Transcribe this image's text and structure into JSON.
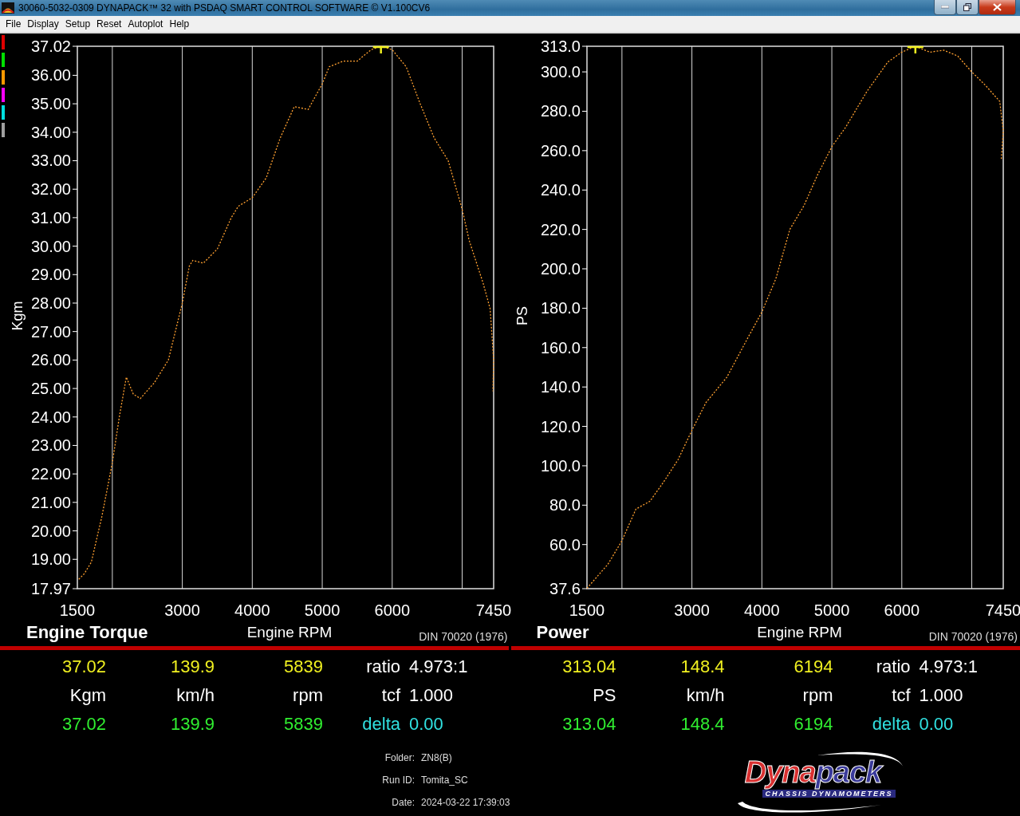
{
  "window": {
    "title": "30060-5032-0309 DYNAPACK™ 32 with PSDAQ SMART CONTROL SOFTWARE © V1.100CV6"
  },
  "menu": [
    "File",
    "Display",
    "Setup",
    "Reset",
    "Autoplot",
    "Help"
  ],
  "run_markers": [
    {
      "color": "#e00000"
    },
    {
      "color": "#00e000"
    },
    {
      "color": "#ff9900"
    },
    {
      "color": "#ff00ff"
    },
    {
      "color": "#00e0e0"
    },
    {
      "color": "#a0a0a0"
    }
  ],
  "charts": [
    {
      "title": "Engine Torque",
      "standard": "DIN 70020 (1976)",
      "chart_data": {
        "type": "line",
        "xlabel": "Engine RPM",
        "ylabel": "Kgm",
        "xlim": [
          1500,
          7450
        ],
        "ylim": [
          17.97,
          37.02
        ],
        "xticks": [
          1500,
          3000,
          4000,
          5000,
          6000,
          7450
        ],
        "yticks": [
          {
            "value": 17.97,
            "label": "17.97"
          },
          {
            "value": 19,
            "label": "19.00"
          },
          {
            "value": 20,
            "label": "20.00"
          },
          {
            "value": 21,
            "label": "21.00"
          },
          {
            "value": 22,
            "label": "22.00"
          },
          {
            "value": 23,
            "label": "23.00"
          },
          {
            "value": 24,
            "label": "24.00"
          },
          {
            "value": 25,
            "label": "25.00"
          },
          {
            "value": 26,
            "label": "26.00"
          },
          {
            "value": 27,
            "label": "27.00"
          },
          {
            "value": 28,
            "label": "28.00"
          },
          {
            "value": 29,
            "label": "29.00"
          },
          {
            "value": 30,
            "label": "30.00"
          },
          {
            "value": 31,
            "label": "31.00"
          },
          {
            "value": 32,
            "label": "32.00"
          },
          {
            "value": 33,
            "label": "33.00"
          },
          {
            "value": 34,
            "label": "34.00"
          },
          {
            "value": 35,
            "label": "35.00"
          },
          {
            "value": 36,
            "label": "36.00"
          },
          {
            "value": 37.02,
            "label": "37.02"
          }
        ],
        "x": [
          1520,
          1600,
          1700,
          1850,
          2000,
          2100,
          2200,
          2300,
          2400,
          2600,
          2800,
          3000,
          3100,
          3150,
          3300,
          3500,
          3700,
          3800,
          4000,
          4200,
          4400,
          4600,
          4800,
          5000,
          5100,
          5300,
          5500,
          5700,
          5839,
          6000,
          6200,
          6400,
          6600,
          6800,
          7000,
          7100,
          7300,
          7400,
          7450,
          7440
        ],
        "grid": true,
        "series": [
          {
            "color": "#ffa030",
            "line_style": "dotted",
            "values": [
              18.3,
              18.5,
              18.9,
              20.5,
              22.4,
              24.0,
              25.4,
              24.8,
              24.65,
              25.2,
              26.0,
              28.0,
              29.3,
              29.5,
              29.4,
              29.9,
              31.0,
              31.4,
              31.7,
              32.4,
              33.8,
              34.9,
              34.8,
              35.7,
              36.3,
              36.5,
              36.5,
              36.9,
              37.02,
              36.9,
              36.3,
              35.0,
              33.8,
              33.0,
              31.3,
              30.2,
              28.7,
              27.8,
              26.0,
              24.9
            ]
          }
        ]
      }
    },
    {
      "title": "Power",
      "standard": "DIN 70020 (1976)",
      "chart_data": {
        "type": "line",
        "xlabel": "Engine RPM",
        "ylabel": "PS",
        "xlim": [
          1500,
          7450
        ],
        "ylim": [
          37.6,
          313.0
        ],
        "xticks": [
          1500,
          3000,
          4000,
          5000,
          6000,
          7450
        ],
        "yticks": [
          {
            "value": 37.6,
            "label": "37.6"
          },
          {
            "value": 60,
            "label": "60.0"
          },
          {
            "value": 80,
            "label": "80.0"
          },
          {
            "value": 100,
            "label": "100.0"
          },
          {
            "value": 120,
            "label": "120.0"
          },
          {
            "value": 140,
            "label": "140.0"
          },
          {
            "value": 160,
            "label": "160.0"
          },
          {
            "value": 180,
            "label": "180.0"
          },
          {
            "value": 200,
            "label": "200.0"
          },
          {
            "value": 220,
            "label": "220.0"
          },
          {
            "value": 240,
            "label": "240.0"
          },
          {
            "value": 260,
            "label": "260.0"
          },
          {
            "value": 280,
            "label": "280.0"
          },
          {
            "value": 300,
            "label": "300.0"
          },
          {
            "value": 313,
            "label": "313.0"
          }
        ],
        "x": [
          1500,
          1800,
          2000,
          2200,
          2400,
          2600,
          2800,
          3000,
          3200,
          3500,
          3800,
          4000,
          4200,
          4400,
          4600,
          4800,
          5000,
          5200,
          5500,
          5800,
          6000,
          6194,
          6400,
          6600,
          6800,
          7000,
          7200,
          7400,
          7450,
          7420
        ],
        "grid": true,
        "series": [
          {
            "color": "#ffa030",
            "line_style": "dotted",
            "values": [
              37.8,
              50,
              62,
              78,
              82,
              92,
              103,
              118,
              132,
              145,
              165,
              178,
              195,
              220,
              232,
              248,
              262,
              272,
              290,
              305,
              310,
              313.0,
              310,
              311,
              308,
              300,
              293,
              285,
              270,
              255
            ]
          }
        ]
      }
    }
  ],
  "readouts": [
    {
      "peak": [
        "37.02",
        "139.9",
        "5839"
      ],
      "units": [
        "Kgm",
        "km/h",
        "rpm"
      ],
      "current": [
        "37.02",
        "139.9",
        "5839"
      ],
      "params": [
        {
          "kind": "plain",
          "label": "ratio",
          "value": "4.973:1"
        },
        {
          "kind": "plain",
          "label": "tcf",
          "value": "1.000"
        },
        {
          "kind": "delta",
          "label": "delta",
          "value": "0.00"
        }
      ]
    },
    {
      "peak": [
        "313.04",
        "148.4",
        "6194"
      ],
      "units": [
        "PS",
        "km/h",
        "rpm"
      ],
      "current": [
        "313.04",
        "148.4",
        "6194"
      ],
      "params": [
        {
          "kind": "plain",
          "label": "ratio",
          "value": "4.973:1"
        },
        {
          "kind": "plain",
          "label": "tcf",
          "value": "1.000"
        },
        {
          "kind": "delta",
          "label": "delta",
          "value": "0.00"
        }
      ]
    }
  ],
  "run_info": [
    {
      "label": "Folder:",
      "value": "ZN8(B)"
    },
    {
      "label": "Run ID:",
      "value": "Tomita_SC"
    },
    {
      "label": "Date:",
      "value": "2024-03-22 17:39:03"
    }
  ],
  "logo": {
    "brand_parts": [
      "Dyna",
      "pack"
    ],
    "tagline": "CHASSIS DYNAMOMETERS"
  }
}
